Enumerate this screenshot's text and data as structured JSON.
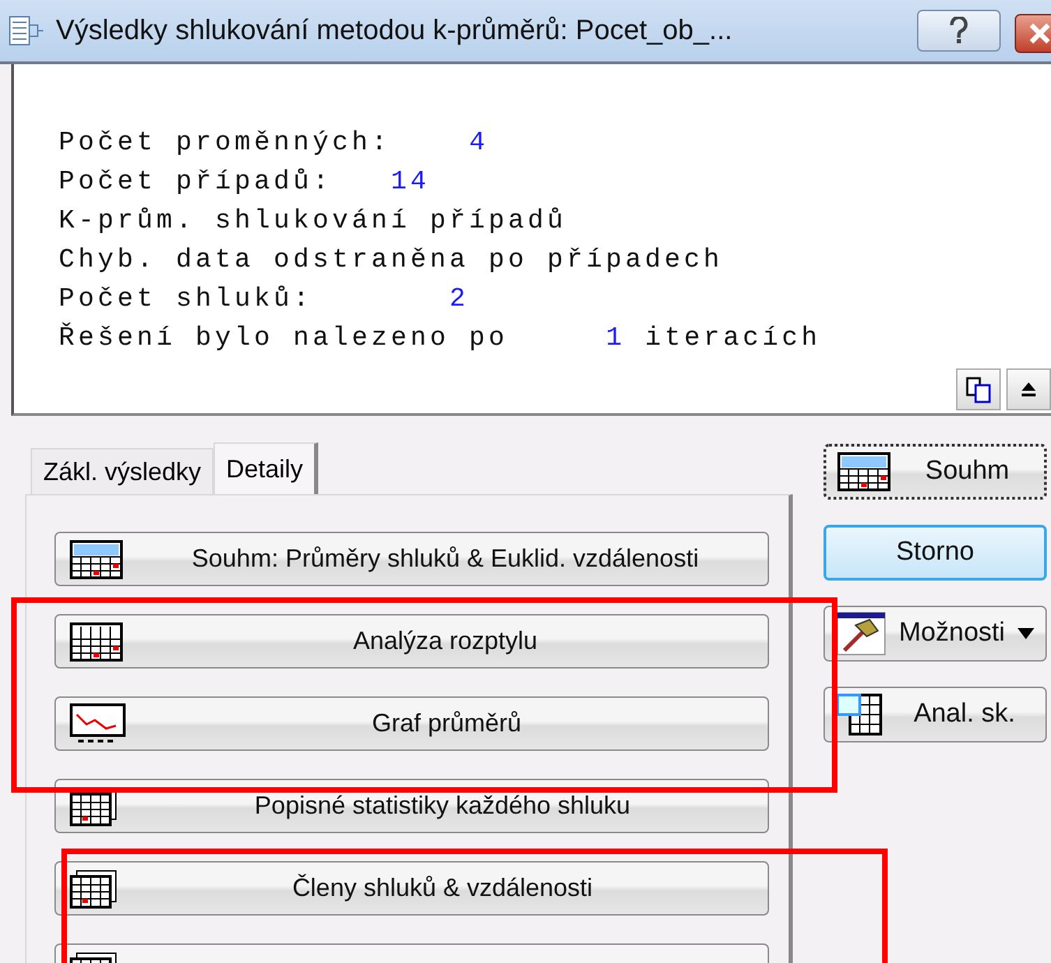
{
  "window": {
    "title": "Výsledky shlukování metodou k-průměrů: Pocet_ob_..."
  },
  "output_lines": [
    {
      "label": "Počet proměnných:",
      "value": "4"
    },
    {
      "label": "Počet případů:",
      "value": "14"
    },
    {
      "label": "K-prům. shlukování případů"
    },
    {
      "label": "Chyb. data odstraněna po případech"
    },
    {
      "label": "Počet shluků:",
      "value": "2"
    },
    {
      "label": "Řešení bylo nalezeno po",
      "value": "1",
      "suffix": "iteracích"
    }
  ],
  "tabs": [
    {
      "label": "Zákl. výsledky",
      "selected": false
    },
    {
      "label": "Detaily",
      "selected": true
    }
  ],
  "result_buttons": [
    {
      "kind": "summary",
      "label": "Souhm: Průměry shluků & Euklid. vzdálenosti"
    },
    {
      "kind": "table",
      "label": "Analýza rozptylu"
    },
    {
      "kind": "graph",
      "label": "Graf průměrů"
    },
    {
      "kind": "stack",
      "label": "Popisné statistiky každého shluku"
    },
    {
      "kind": "stack",
      "label": "Členy shluků & vzdálenosti"
    },
    {
      "kind": "cut"
    }
  ],
  "side_buttons": [
    {
      "kind": "summary",
      "label": "Souhm",
      "focused": true,
      "default": false
    },
    {
      "kind": "plain",
      "label": "Storno",
      "focused": false,
      "default": true
    },
    {
      "kind": "options",
      "label": "Možnosti"
    },
    {
      "kind": "analysis",
      "label": "Anal. sk."
    }
  ],
  "highlight_frames": [
    {
      "kind": "frame"
    },
    {
      "kind": "frame"
    }
  ]
}
